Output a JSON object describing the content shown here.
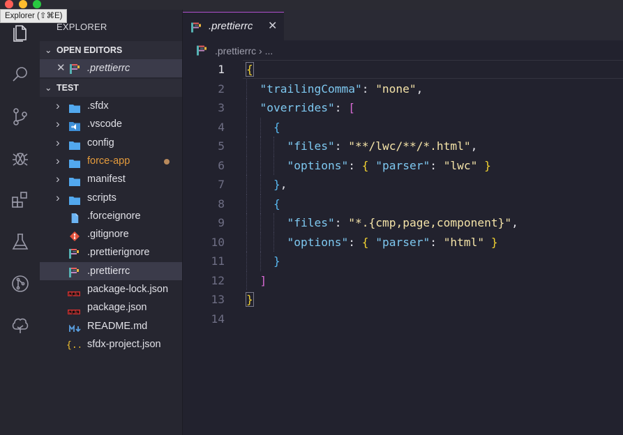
{
  "window": {
    "tooltip": "Explorer (⇧⌘E)"
  },
  "colors": {
    "accent": "#b14fd0",
    "traffic_red": "#fe5f57",
    "traffic_yellow": "#febc2e",
    "traffic_green": "#28c840",
    "folder": "#52a8ee",
    "modified_dot": "#b98a5c"
  },
  "activity_bar": [
    {
      "icon": "files-icon",
      "active": true
    },
    {
      "icon": "search-icon"
    },
    {
      "icon": "source-control-icon"
    },
    {
      "icon": "debug-icon"
    },
    {
      "icon": "extensions-icon"
    },
    {
      "icon": "testing-flask-icon"
    },
    {
      "icon": "git-remote-icon"
    },
    {
      "icon": "tree-icon"
    }
  ],
  "sidebar": {
    "title": "EXPLORER",
    "open_editors": {
      "label": "OPEN EDITORS",
      "items": [
        {
          "name": ".prettierrc",
          "icon": "prettier-icon"
        }
      ]
    },
    "folder": {
      "label": "TEST",
      "items": [
        {
          "name": ".sfdx",
          "type": "folder",
          "icon": "folder-icon"
        },
        {
          "name": ".vscode",
          "type": "folder",
          "icon": "vscode-folder-icon"
        },
        {
          "name": "config",
          "type": "folder",
          "icon": "folder-icon"
        },
        {
          "name": "force-app",
          "type": "folder",
          "icon": "folder-icon",
          "modified": true
        },
        {
          "name": "manifest",
          "type": "folder",
          "icon": "folder-icon"
        },
        {
          "name": "scripts",
          "type": "folder",
          "icon": "folder-icon"
        },
        {
          "name": ".forceignore",
          "type": "file",
          "icon": "file-icon"
        },
        {
          "name": ".gitignore",
          "type": "file",
          "icon": "git-icon"
        },
        {
          "name": ".prettierignore",
          "type": "file",
          "icon": "prettier-icon"
        },
        {
          "name": ".prettierrc",
          "type": "file",
          "icon": "prettier-icon",
          "selected": true
        },
        {
          "name": "package-lock.json",
          "type": "file",
          "icon": "npm-icon"
        },
        {
          "name": "package.json",
          "type": "file",
          "icon": "npm-icon"
        },
        {
          "name": "README.md",
          "type": "file",
          "icon": "markdown-icon"
        },
        {
          "name": "sfdx-project.json",
          "type": "file",
          "icon": "json-icon"
        }
      ]
    }
  },
  "editor": {
    "tab": {
      "label": ".prettierrc"
    },
    "breadcrumb": {
      "file": ".prettierrc",
      "rest": "..."
    },
    "current_line": 1,
    "lines": [
      "{",
      "  \"trailingComma\": \"none\",",
      "  \"overrides\": [",
      "    {",
      "      \"files\": \"**/lwc/**/*.html\",",
      "      \"options\": { \"parser\": \"lwc\" }",
      "    },",
      "    {",
      "      \"files\": \"*.{cmp,page,component}\",",
      "      \"options\": { \"parser\": \"html\" }",
      "    }",
      "  ]",
      "}",
      ""
    ]
  }
}
